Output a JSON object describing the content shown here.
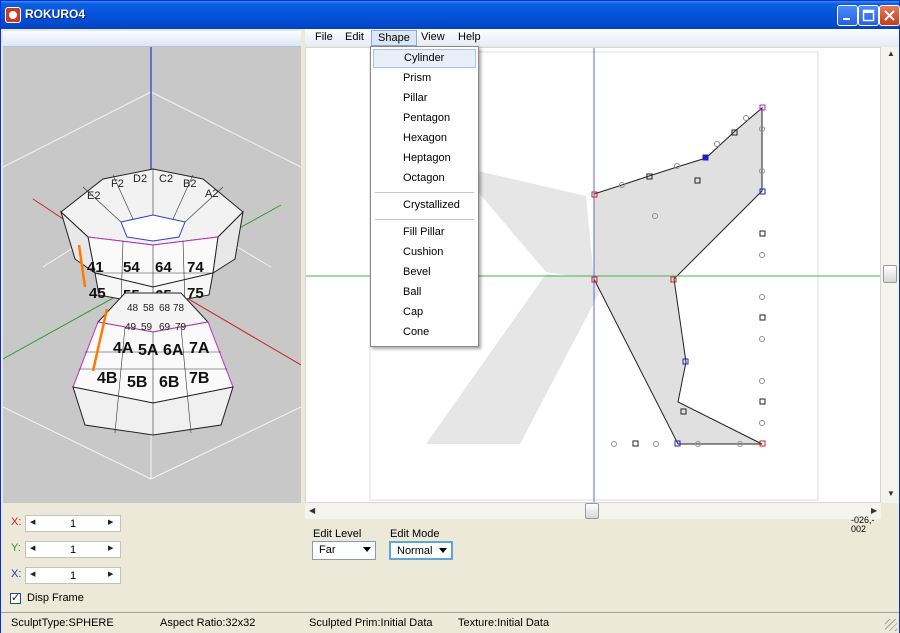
{
  "window": {
    "title": "ROKURO4"
  },
  "menu": {
    "items": [
      {
        "label": "File"
      },
      {
        "label": "Edit"
      },
      {
        "label": "Shape"
      },
      {
        "label": "View"
      },
      {
        "label": "Help"
      }
    ]
  },
  "shape_menu": {
    "group1": [
      "Cylinder",
      "Prism",
      "Pillar",
      "Pentagon",
      "Hexagon",
      "Heptagon",
      "Octagon"
    ],
    "group2": [
      "Crystallized"
    ],
    "group3": [
      "Fill Pillar",
      "Cushion",
      "Bevel",
      "Ball",
      "Cap",
      "Cone"
    ],
    "highlighted": "Cylinder"
  },
  "preview": {
    "cells": [
      "41",
      "54",
      "64",
      "74",
      "45",
      "55",
      "65",
      "75",
      "48",
      "58",
      "68",
      "78",
      "49",
      "59",
      "69",
      "79",
      "4A",
      "5A",
      "6A",
      "7A",
      "4B",
      "5B",
      "6B",
      "7B",
      "E2",
      "F2",
      "D2",
      "C2",
      "B2",
      "A2"
    ]
  },
  "controls": {
    "x1": {
      "label": "X:",
      "value": "1"
    },
    "y": {
      "label": "Y:",
      "value": "1"
    },
    "x2": {
      "label": "X:",
      "value": "1"
    },
    "disp_frame": {
      "label": "Disp Frame",
      "checked": true
    },
    "edit_level": {
      "label": "Edit Level",
      "value": "Far"
    },
    "edit_mode": {
      "label": "Edit Mode",
      "value": "Normal"
    }
  },
  "coord_readout": {
    "line1": "-026,-",
    "line2": "002"
  },
  "status": {
    "sculpt_type": "SculptType:SPHERE",
    "aspect_ratio": "Aspect Ratio:32x32",
    "sculpted_prim": "Sculpted Prim:Initial Data",
    "texture": "Texture:Initial Data"
  },
  "colors": {
    "title_bar": "#0553db",
    "x_axis": "#4caf50",
    "y_axis": "#4a4ae0",
    "profile_fill": "#e0e0e0",
    "point_red": "#d02020",
    "point_blue": "#2020c0",
    "point_magenta": "#c020c0"
  }
}
